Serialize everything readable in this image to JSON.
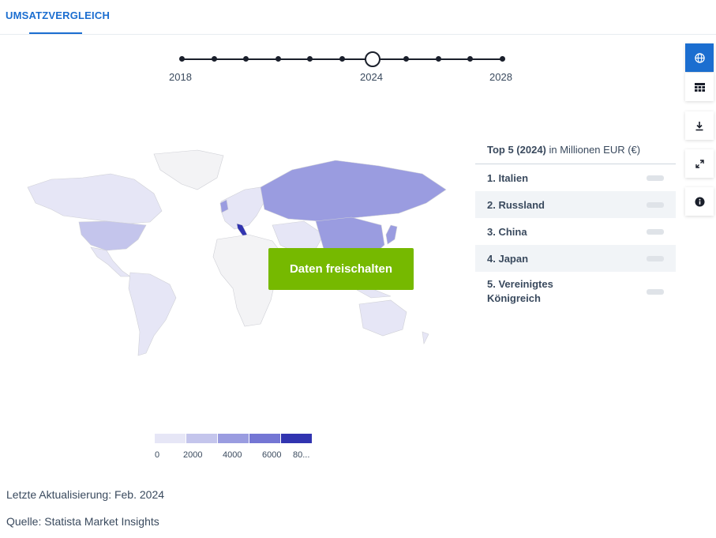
{
  "tab": {
    "label": "UMSATZVERGLEICH"
  },
  "timeline": {
    "labels": [
      "2018",
      "2024",
      "2028"
    ],
    "selected": "2024"
  },
  "unlock_button": "Daten freischalten",
  "legend": {
    "labels": [
      "0",
      "2000",
      "4000",
      "6000",
      "80..."
    ],
    "colors": [
      "#e6e6f6",
      "#c4c5ec",
      "#9a9ce0",
      "#7476d4",
      "#3134b0"
    ]
  },
  "top5": {
    "title_bold": "Top 5 (2024)",
    "title_rest": " in Millionen EUR (€)",
    "items": [
      {
        "rank": "1.",
        "name": "Italien"
      },
      {
        "rank": "2.",
        "name": "Russland"
      },
      {
        "rank": "3.",
        "name": "China"
      },
      {
        "rank": "4.",
        "name": "Japan"
      },
      {
        "rank": "5.",
        "name": "Vereinigtes Königreich"
      }
    ]
  },
  "meta": {
    "updated": "Letzte Aktualisierung: Feb. 2024",
    "source": "Quelle: Statista Market Insights"
  },
  "colors": {
    "accent": "#1b6ed0",
    "unlock": "#76b900"
  }
}
